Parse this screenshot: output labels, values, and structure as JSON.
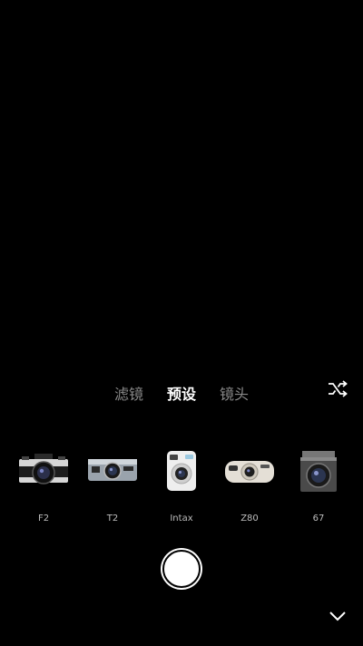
{
  "mode_tabs": [
    {
      "label": "滤镜",
      "active": false
    },
    {
      "label": "预设",
      "active": true
    },
    {
      "label": "镜头",
      "active": false
    }
  ],
  "icons": {
    "shuffle": "shuffle-icon",
    "collapse": "chevron-down-icon",
    "shutter": "shutter-icon"
  },
  "cameras": [
    {
      "label": "F2",
      "icon": "slr-camera-icon"
    },
    {
      "label": "T2",
      "icon": "compact-camera-icon"
    },
    {
      "label": "Intax",
      "icon": "instant-camera-icon"
    },
    {
      "label": "Z80",
      "icon": "point-and-shoot-camera-icon"
    },
    {
      "label": "67",
      "icon": "medium-format-camera-icon"
    }
  ],
  "colors": {
    "background": "#000000",
    "tab_active": "#ffffff",
    "tab_inactive": "#8a8a8a",
    "label": "#bdbdbd"
  }
}
